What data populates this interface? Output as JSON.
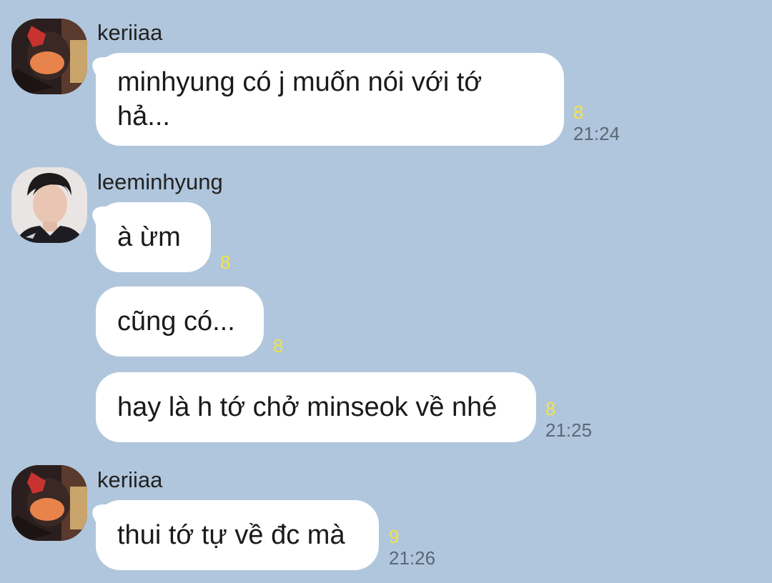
{
  "colors": {
    "background": "#b0c6dc",
    "bubble": "#ffffff",
    "read_count": "#f2e24a",
    "time": "#5b6876"
  },
  "messages": [
    {
      "sender": "keriiaa",
      "avatar_icon": "keriiaa-avatar",
      "text": "minhyung có j muốn nói với tớ\nhả...",
      "read_count": "8",
      "time": "21:24"
    },
    {
      "sender": "leeminhyung",
      "avatar_icon": "leeminhyung-avatar",
      "text": "à ừm",
      "read_count": "8",
      "time": ""
    },
    {
      "text": "cũng có...",
      "read_count": "8",
      "time": ""
    },
    {
      "text": "hay là h tớ chở minseok về nhé",
      "read_count": "8",
      "time": "21:25"
    },
    {
      "sender": "keriiaa",
      "avatar_icon": "keriiaa-avatar",
      "text": "thui tớ tự về đc mà",
      "read_count": "9",
      "time": "21:26"
    }
  ]
}
